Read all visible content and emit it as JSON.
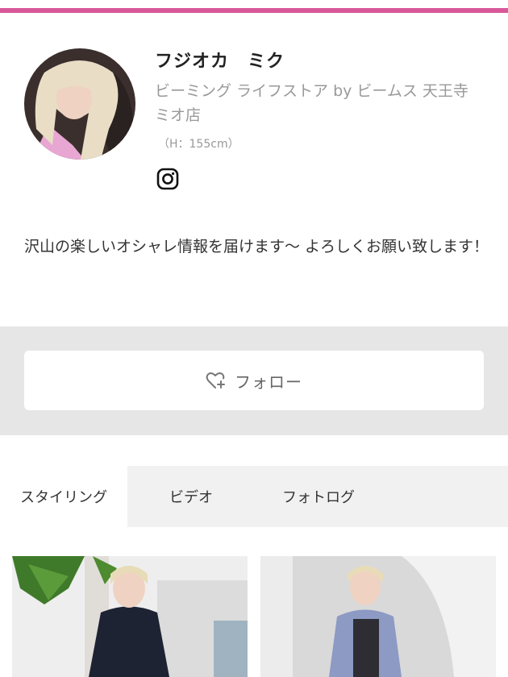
{
  "profile": {
    "name": "フジオカ　ミク",
    "shop": "ビーミング ライフストア by ビームス 天王寺ミオ店",
    "height": "（H：155cm）",
    "bio": "沢山の楽しいオシャレ情報を届けます〜 よろしくお願い致します！"
  },
  "follow": {
    "label": "フォロー"
  },
  "tabs": [
    {
      "label": "スタイリング",
      "active": true
    },
    {
      "label": "ビデオ",
      "active": false
    },
    {
      "label": "フォトログ",
      "active": false
    }
  ],
  "icons": [
    "instagram-icon",
    "heart-plus-icon"
  ],
  "colors": {
    "accent_bar": "#d8589a",
    "muted_text": "#999999",
    "band": "#e6e6e6"
  }
}
